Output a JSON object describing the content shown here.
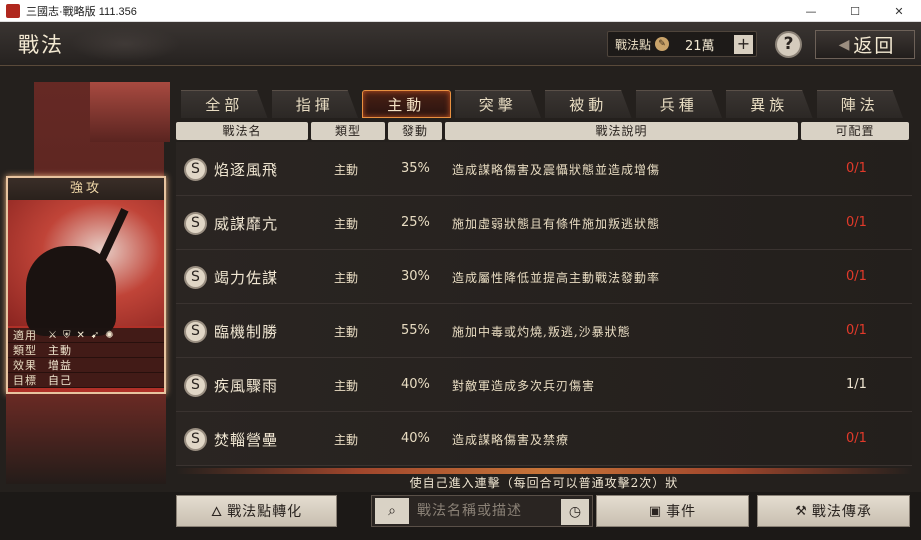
{
  "window": {
    "title": "三國志·戰略版 111.356",
    "controls": [
      "—",
      "☐",
      "✕"
    ]
  },
  "header": {
    "page_title": "戰法",
    "points_label": "戰法點",
    "points_value": "21萬",
    "plus_label": "+",
    "help_label": "?",
    "back_label": "返回"
  },
  "card": {
    "title": "強攻",
    "apply_label": "適用",
    "apply_icons": [
      "⚔",
      "⛨",
      "✕",
      "➹",
      "✺"
    ],
    "type_label": "類型",
    "type_value": "主動",
    "effect_label": "效果",
    "effect_value": "增益",
    "target_label": "目標",
    "target_value": "自己"
  },
  "tabs": [
    {
      "label": "全部"
    },
    {
      "label": "指揮"
    },
    {
      "label": "主動"
    },
    {
      "label": "突擊"
    },
    {
      "label": "被動"
    },
    {
      "label": "兵種"
    },
    {
      "label": "異族"
    },
    {
      "label": "陣法"
    }
  ],
  "columns": {
    "name": "戰法名",
    "type": "類型",
    "rate": "發動",
    "desc": "戰法說明",
    "slots": "可配置"
  },
  "rows": [
    {
      "grade": "S",
      "name": "焰逐風飛",
      "type": "主動",
      "rate": "35%",
      "desc": "造成謀略傷害及震懾狀態並造成增傷",
      "slots": "0/1"
    },
    {
      "grade": "S",
      "name": "威謀靡亢",
      "type": "主動",
      "rate": "25%",
      "desc": "施加虛弱狀態且有條件施加叛逃狀態",
      "slots": "0/1"
    },
    {
      "grade": "S",
      "name": "竭力佐謀",
      "type": "主動",
      "rate": "30%",
      "desc": "造成屬性降低並提高主動戰法發動率",
      "slots": "0/1"
    },
    {
      "grade": "S",
      "name": "臨機制勝",
      "type": "主動",
      "rate": "55%",
      "desc": "施加中毒或灼燒,叛逃,沙暴狀態",
      "slots": "0/1"
    },
    {
      "grade": "S",
      "name": "疾風驟雨",
      "type": "主動",
      "rate": "40%",
      "desc": "對敵軍造成多次兵刃傷害",
      "slots": "1/1"
    },
    {
      "grade": "S",
      "name": "焚輜營壘",
      "type": "主動",
      "rate": "40%",
      "desc": "造成謀略傷害及禁療",
      "slots": "0/1"
    }
  ],
  "tip": "使自己進入連擊（每回合可以普通攻擊2次）狀",
  "bottom": {
    "convert_label": "戰法點轉化",
    "search_placeholder": "戰法名稱或描述",
    "events_label": "事件",
    "inherit_label": "戰法傳承"
  },
  "colors": {
    "accent": "#e89040",
    "unavailable": "#e23a2a",
    "card_frame": "#e8c4a0"
  }
}
